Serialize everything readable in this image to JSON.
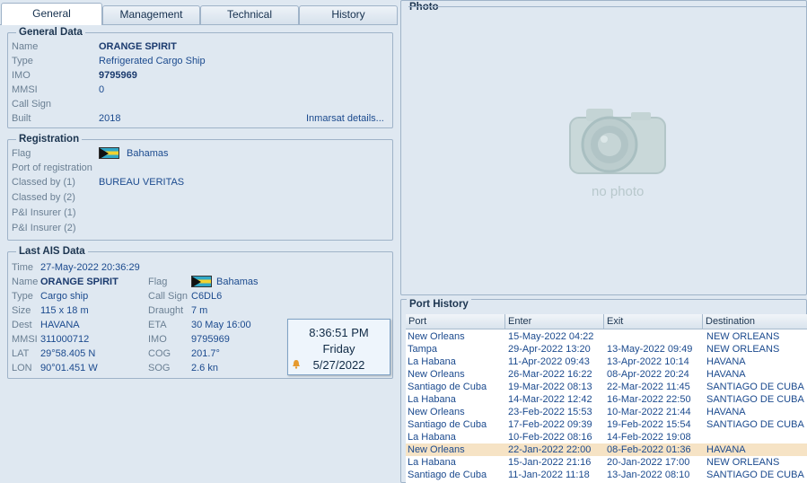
{
  "tabs": [
    "General",
    "Management",
    "Technical",
    "History"
  ],
  "general_data": {
    "title": "General Data",
    "name_label": "Name",
    "name": "ORANGE SPIRIT",
    "type_label": "Type",
    "type": "Refrigerated Cargo Ship",
    "imo_label": "IMO",
    "imo": "9795969",
    "mmsi_label": "MMSI",
    "mmsi": "0",
    "callsign_label": "Call Sign",
    "callsign": "",
    "built_label": "Built",
    "built": "2018",
    "inmarsat_link": "Inmarsat details..."
  },
  "registration": {
    "title": "Registration",
    "flag_label": "Flag",
    "flag": "Bahamas",
    "port_label": "Port of registration",
    "port": "",
    "classed1_label": "Classed by (1)",
    "classed1": "BUREAU VERITAS",
    "classed2_label": "Classed by (2)",
    "classed2": "",
    "pi1_label": "P&I Insurer (1)",
    "pi1": "",
    "pi2_label": "P&I Insurer (2)",
    "pi2": ""
  },
  "ais": {
    "title": "Last AIS Data",
    "time_label": "Time",
    "time": "27-May-2022 20:36:29",
    "name_label": "Name",
    "name": "ORANGE SPIRIT",
    "type_label": "Type",
    "type": "Cargo ship",
    "size_label": "Size",
    "size": "115 x 18 m",
    "dest_label": "Dest",
    "dest": "HAVANA",
    "mmsi_label": "MMSI",
    "mmsi": "311000712",
    "lat_label": "LAT",
    "lat": "29°58.405 N",
    "lon_label": "LON",
    "lon": "90°01.451 W",
    "flag_label": "Flag",
    "flag": "Bahamas",
    "callsign_label": "Call Sign",
    "callsign": "C6DL6",
    "draught_label": "Draught",
    "draught": "7 m",
    "eta_label": "ETA",
    "eta": "30 May 16:00",
    "imo_label": "IMO",
    "imo": "9795969",
    "cog_label": "COG",
    "cog": "201.7°",
    "sog_label": "SOG",
    "sog": "2.6 kn"
  },
  "clock": {
    "time": "8:36:51 PM",
    "day": "Friday",
    "date": "5/27/2022"
  },
  "photo": {
    "title": "Photo",
    "placeholder": "no photo"
  },
  "port_history": {
    "title": "Port History",
    "columns": [
      "Port",
      "Enter",
      "Exit",
      "Destination"
    ],
    "rows": [
      [
        "New Orleans",
        "15-May-2022 04:22",
        "",
        "NEW ORLEANS"
      ],
      [
        "Tampa",
        "29-Apr-2022 13:20",
        "13-May-2022 09:49",
        "NEW ORLEANS"
      ],
      [
        "La Habana",
        "11-Apr-2022 09:43",
        "13-Apr-2022 10:14",
        "HAVANA"
      ],
      [
        "New Orleans",
        "26-Mar-2022 16:22",
        "08-Apr-2022 20:24",
        "HAVANA"
      ],
      [
        "Santiago de Cuba",
        "19-Mar-2022 08:13",
        "22-Mar-2022 11:45",
        "SANTIAGO DE CUBA"
      ],
      [
        "La Habana",
        "14-Mar-2022 12:42",
        "16-Mar-2022 22:50",
        "SANTIAGO DE CUBA"
      ],
      [
        "New Orleans",
        "23-Feb-2022 15:53",
        "10-Mar-2022 21:44",
        "HAVANA"
      ],
      [
        "Santiago de Cuba",
        "17-Feb-2022 09:39",
        "19-Feb-2022 15:54",
        "SANTIAGO DE CUBA"
      ],
      [
        "La Habana",
        "10-Feb-2022 08:16",
        "14-Feb-2022 19:08",
        ""
      ],
      [
        "New Orleans",
        "22-Jan-2022 22:00",
        "08-Feb-2022 01:36",
        "HAVANA"
      ],
      [
        "La Habana",
        "15-Jan-2022 21:16",
        "20-Jan-2022 17:00",
        "NEW ORLEANS"
      ],
      [
        "Santiago de Cuba",
        "11-Jan-2022 11:18",
        "13-Jan-2022 08:10",
        "SANTIAGO DE CUBA"
      ]
    ],
    "selected_row": 9
  }
}
